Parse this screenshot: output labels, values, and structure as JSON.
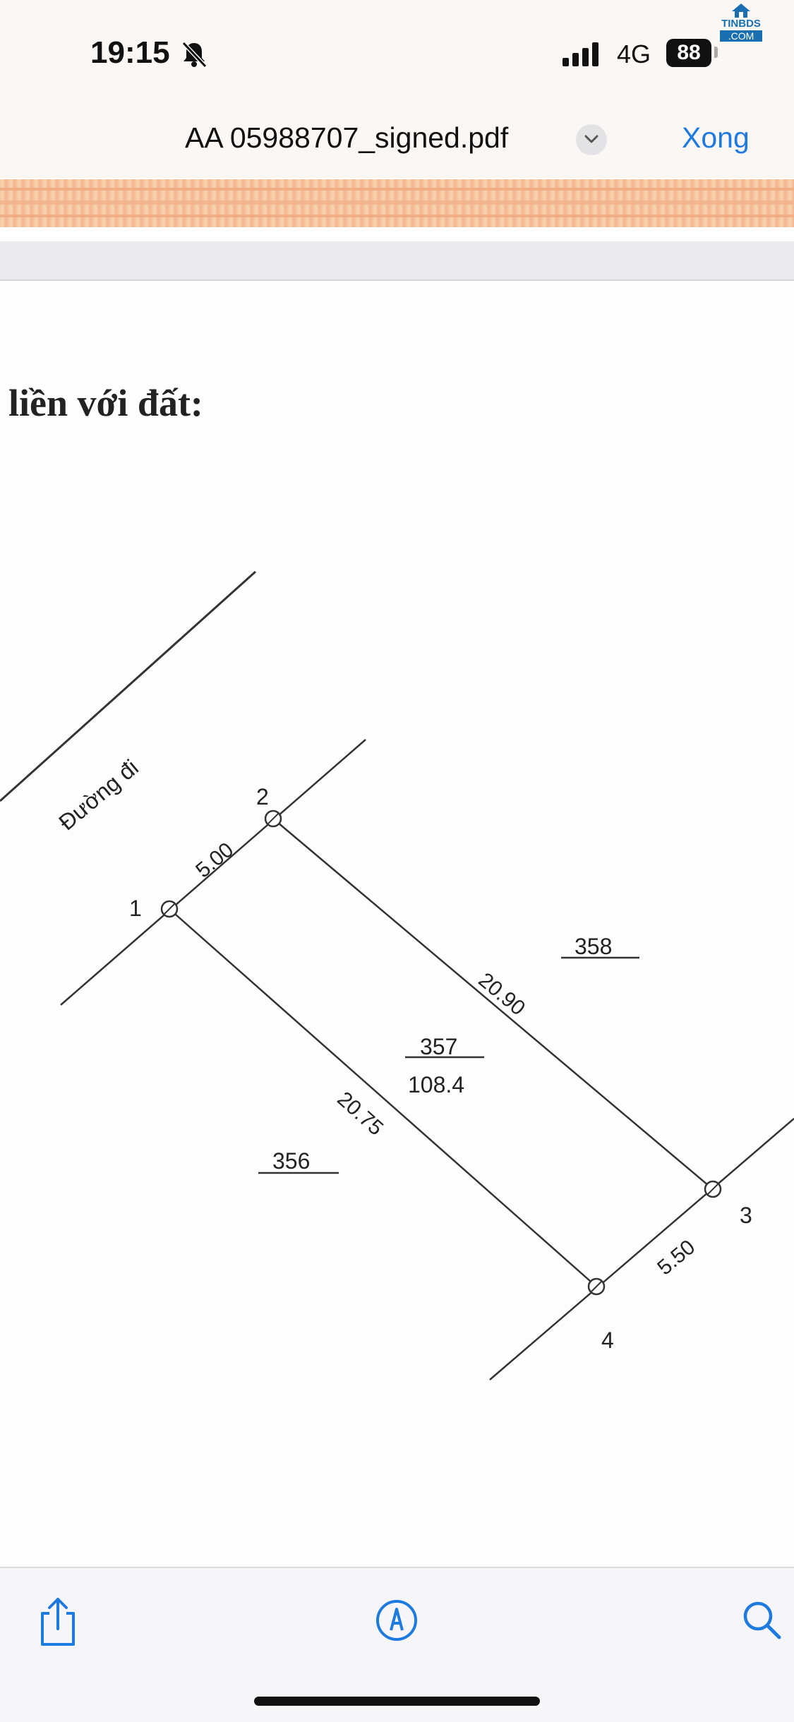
{
  "status_bar": {
    "time": "19:15",
    "network": "4G",
    "battery": "88"
  },
  "watermark": {
    "brand": "TINBDS",
    "suffix": ".COM"
  },
  "header": {
    "file_name": "AA 05988707_signed.pdf",
    "done_label": "Xong"
  },
  "document": {
    "heading": "liền với đất:",
    "road_label": "Đường đi",
    "points": {
      "p1": "1",
      "p2": "2",
      "p3": "3",
      "p4": "4"
    },
    "edges": {
      "edge_1_2": "5.00",
      "edge_2_3": "20.90",
      "edge_1_4": "20.75",
      "edge_3_4": "5.50"
    },
    "parcels": {
      "main_id": "357",
      "main_area": "108.4",
      "neighbor_right": "358",
      "neighbor_left": "356"
    }
  },
  "colors": {
    "accent": "#1f7ae0",
    "line": "#333333"
  },
  "icons": {
    "share": "share-icon",
    "markup": "markup-icon",
    "search": "search-icon",
    "dropdown": "chevron-down-icon",
    "mute": "bell-slash-icon"
  }
}
